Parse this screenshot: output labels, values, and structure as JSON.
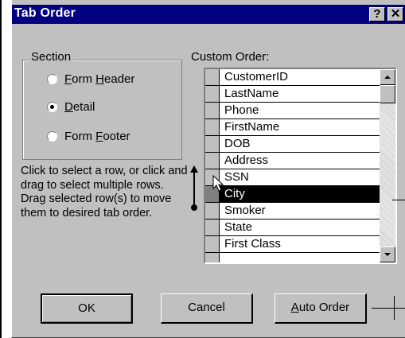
{
  "window": {
    "title": "Tab Order",
    "help_glyph": "?",
    "close_glyph": "✕"
  },
  "section": {
    "label": "Section",
    "options": [
      {
        "label": "Form Header",
        "selected": false
      },
      {
        "label": "Detail",
        "selected": true
      },
      {
        "label": "Form Footer",
        "selected": false
      }
    ]
  },
  "instructions": "Click to select a row, or click and drag to select multiple rows.  Drag selected row(s) to move them to desired tab order.",
  "custom_order": {
    "label": "Custom Order:",
    "rows": [
      {
        "label": "CustomerID",
        "selected": false
      },
      {
        "label": "LastName",
        "selected": false
      },
      {
        "label": "Phone",
        "selected": false
      },
      {
        "label": "FirstName",
        "selected": false
      },
      {
        "label": "DOB",
        "selected": false
      },
      {
        "label": "Address",
        "selected": false
      },
      {
        "label": "SSN",
        "selected": false
      },
      {
        "label": "City",
        "selected": true
      },
      {
        "label": "Smoker",
        "selected": false
      },
      {
        "label": "State",
        "selected": false
      },
      {
        "label": "First Class",
        "selected": false
      }
    ]
  },
  "buttons": {
    "ok": "OK",
    "cancel": "Cancel",
    "auto_order": "Auto Order"
  },
  "colors": {
    "titlebar": "#000080",
    "face": "#c0c0c0",
    "selection": "#000000"
  },
  "icons": [
    "help-icon",
    "close-icon",
    "scroll-up-icon",
    "scroll-down-icon",
    "pointer-cursor-icon",
    "drag-arrow-icon"
  ]
}
